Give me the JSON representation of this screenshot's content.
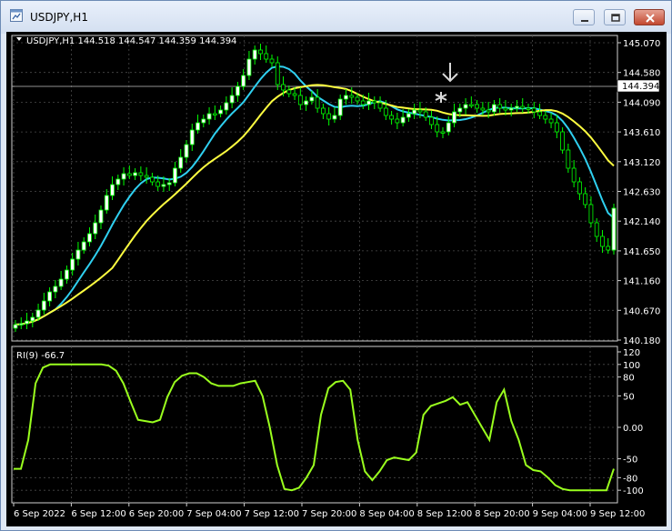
{
  "window": {
    "title": "USDJPY,H1"
  },
  "price_chart": {
    "header": "USDJPY,H1  144.518 144.547 144.359 144.394",
    "current_price": "144.394",
    "y_ticks": [
      "145.070",
      "144.580",
      "144.090",
      "143.610",
      "143.120",
      "142.630",
      "142.140",
      "141.650",
      "141.160",
      "140.670",
      "140.180"
    ],
    "colors": {
      "background": "#000000",
      "grid": "#4a4a4a",
      "candle": "#00ff00",
      "fast_ma": "#2fd0f0",
      "slow_ma": "#ffff40",
      "arrow": "#d9d9d9"
    }
  },
  "rsi_panel": {
    "header": "RI(9) -66.7",
    "y_ticks": [
      "120",
      "100",
      "80",
      "50",
      "0.00",
      "-50",
      "-80",
      "-100"
    ],
    "line_color": "#9aff1e"
  },
  "time_axis": [
    "6 Sep 2022",
    "6 Sep 12:00",
    "6 Sep 20:00",
    "7 Sep 04:00",
    "7 Sep 12:00",
    "7 Sep 20:00",
    "8 Sep 04:00",
    "8 Sep 12:00",
    "8 Sep 20:00",
    "9 Sep 04:00",
    "9 Sep 12:00"
  ]
}
